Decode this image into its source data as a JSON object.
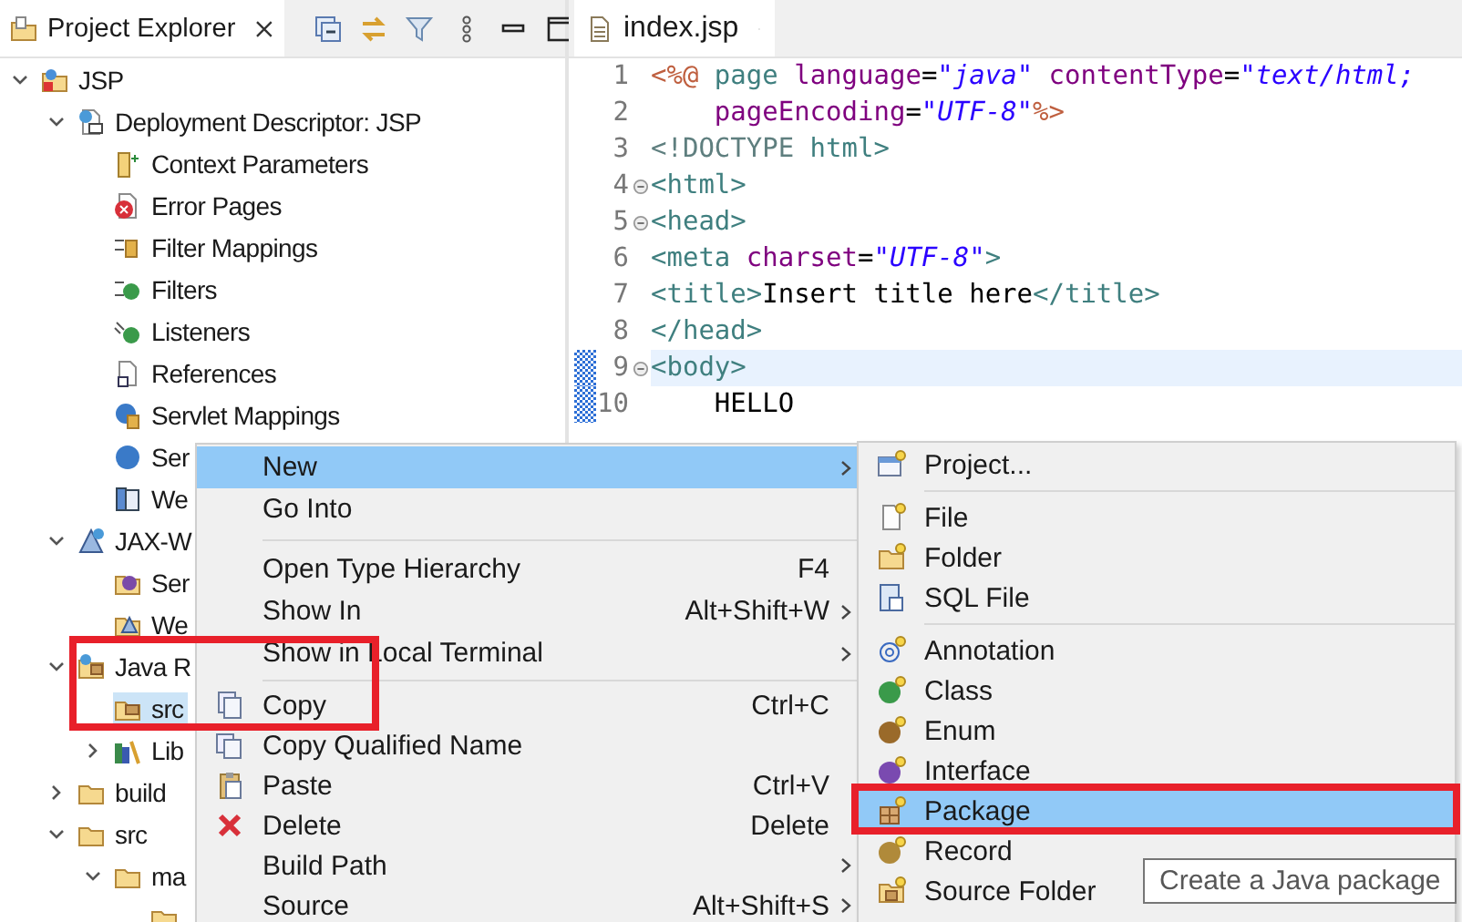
{
  "explorer": {
    "tab": {
      "title": "Project Explorer",
      "selected": true
    },
    "tree": [
      {
        "label": "JSP",
        "kind": "web-project",
        "expanded": true,
        "selected": false,
        "children": [
          {
            "label": "Deployment Descriptor: JSP",
            "kind": "descriptor",
            "expanded": true,
            "selected": false,
            "children": [
              {
                "label": "Context Parameters",
                "kind": "parameters",
                "selected": false
              },
              {
                "label": "Error Pages",
                "kind": "error-page",
                "selected": false
              },
              {
                "label": "Filter Mappings",
                "kind": "filter-mapping",
                "selected": false
              },
              {
                "label": "Filters",
                "kind": "filter",
                "selected": false
              },
              {
                "label": "Listeners",
                "kind": "listener",
                "selected": false
              },
              {
                "label": "References",
                "kind": "reference",
                "selected": false
              },
              {
                "label": "Servlet Mappings",
                "kind": "servlet-mapping",
                "selected": false
              },
              {
                "label": "Ser",
                "kind": "servlet",
                "selected": false
              },
              {
                "label": "We",
                "kind": "welcome",
                "selected": false
              }
            ]
          },
          {
            "label": "JAX-W",
            "kind": "web-services",
            "expanded": true,
            "selected": false,
            "children": [
              {
                "label": "Ser",
                "kind": "service",
                "selected": false
              },
              {
                "label": "We",
                "kind": "web-service",
                "selected": false
              }
            ]
          },
          {
            "label": "Java R",
            "kind": "java-resources",
            "expanded": true,
            "selected": false,
            "children": [
              {
                "label": "src",
                "kind": "source-folder",
                "selected": true
              },
              {
                "label": "Lib",
                "kind": "library",
                "expanded": false,
                "selected": false
              }
            ]
          },
          {
            "label": "build",
            "kind": "folder",
            "expanded": false,
            "selected": false
          },
          {
            "label": "src",
            "kind": "folder",
            "expanded": true,
            "selected": false,
            "children": [
              {
                "label": "ma",
                "kind": "folder",
                "expanded": true,
                "selected": false,
                "children": [
                  {
                    "kind": "folder",
                    "selected": false
                  }
                ]
              }
            ]
          }
        ]
      }
    ]
  },
  "editor": {
    "tab": {
      "title": "index.jsp",
      "selected": true
    },
    "lines": [
      {
        "number": "1",
        "fold": false,
        "current": false,
        "changed": false,
        "tokens": [
          {
            "kind": "directive",
            "text": "<%@"
          },
          {
            "kind": "keyword",
            "text": " page"
          },
          {
            "kind": "attribute",
            "text": " language"
          },
          {
            "kind": "operator",
            "text": "="
          },
          {
            "kind": "string",
            "text": "\"java\""
          },
          {
            "kind": "attribute",
            "text": " contentType"
          },
          {
            "kind": "operator",
            "text": "="
          },
          {
            "kind": "string",
            "text": "\"text/html;"
          }
        ]
      },
      {
        "number": "2",
        "fold": false,
        "current": false,
        "changed": false,
        "tokens": [
          {
            "kind": "attribute",
            "text": "    pageEncoding"
          },
          {
            "kind": "operator",
            "text": "="
          },
          {
            "kind": "string",
            "text": "\"UTF-8\""
          },
          {
            "kind": "directive",
            "text": "%>"
          }
        ]
      },
      {
        "number": "3",
        "fold": false,
        "current": false,
        "changed": false,
        "tokens": [
          {
            "kind": "doctype",
            "text": "<!DOCTYPE"
          },
          {
            "kind": "tag",
            "text": " html>"
          }
        ]
      },
      {
        "number": "4",
        "fold": true,
        "current": false,
        "changed": false,
        "tokens": [
          {
            "kind": "tag",
            "text": "<html>"
          }
        ]
      },
      {
        "number": "5",
        "fold": true,
        "current": false,
        "changed": false,
        "tokens": [
          {
            "kind": "tag",
            "text": "<head>"
          }
        ]
      },
      {
        "number": "6",
        "fold": false,
        "current": false,
        "changed": false,
        "tokens": [
          {
            "kind": "tag",
            "text": "<meta"
          },
          {
            "kind": "attribute",
            "text": " charset"
          },
          {
            "kind": "operator",
            "text": "="
          },
          {
            "kind": "string",
            "text": "\"UTF-8\""
          },
          {
            "kind": "tag",
            "text": ">"
          }
        ]
      },
      {
        "number": "7",
        "fold": false,
        "current": false,
        "changed": false,
        "tokens": [
          {
            "kind": "tag",
            "text": "<title>"
          },
          {
            "kind": "text",
            "text": "Insert title here"
          },
          {
            "kind": "tag",
            "text": "</title>"
          }
        ]
      },
      {
        "number": "8",
        "fold": false,
        "current": false,
        "changed": false,
        "tokens": [
          {
            "kind": "tag",
            "text": "</head>"
          }
        ]
      },
      {
        "number": "9",
        "fold": true,
        "current": true,
        "changed": true,
        "tokens": [
          {
            "kind": "tag",
            "text": "<body>"
          }
        ]
      },
      {
        "number": "10",
        "fold": false,
        "current": false,
        "changed": true,
        "tokens": [
          {
            "kind": "text",
            "text": "    HELLO"
          }
        ]
      }
    ]
  },
  "context_menu": {
    "groups": [
      [
        {
          "label": "New",
          "kind": "plain",
          "submenu": true,
          "selected": true
        },
        {
          "label": "Go Into",
          "kind": "plain",
          "submenu": false,
          "selected": false
        }
      ],
      [
        {
          "label": "Open Type Hierarchy",
          "kind": "plain",
          "shortcut": "F4",
          "submenu": false,
          "selected": false
        },
        {
          "label": "Show In",
          "kind": "plain",
          "shortcut": "Alt+Shift+W",
          "submenu": true,
          "selected": false
        },
        {
          "label": "Show in Local Terminal",
          "kind": "plain",
          "submenu": true,
          "selected": false
        }
      ],
      [
        {
          "label": "Copy",
          "kind": "copy",
          "shortcut": "Ctrl+C",
          "submenu": false,
          "selected": false
        },
        {
          "label": "Copy Qualified Name",
          "kind": "copy-name",
          "submenu": false,
          "selected": false
        },
        {
          "label": "Paste",
          "kind": "paste",
          "shortcut": "Ctrl+V",
          "submenu": false,
          "selected": false
        },
        {
          "label": "Delete",
          "kind": "delete",
          "shortcut": "Delete",
          "submenu": false,
          "selected": false
        },
        {
          "label": "Build Path",
          "kind": "plain",
          "submenu": true,
          "selected": false
        },
        {
          "label": "Source",
          "kind": "plain",
          "shortcut": "Alt+Shift+S",
          "submenu": true,
          "selected": false
        }
      ]
    ]
  },
  "submenu": {
    "groups": [
      [
        {
          "label": "Project...",
          "kind": "project",
          "selected": false
        }
      ],
      [
        {
          "label": "File",
          "kind": "file",
          "selected": false
        },
        {
          "label": "Folder",
          "kind": "new-folder",
          "selected": false
        },
        {
          "label": "SQL File",
          "kind": "sql-file",
          "selected": false
        }
      ],
      [
        {
          "label": "Annotation",
          "kind": "annotation",
          "selected": false
        },
        {
          "label": "Class",
          "kind": "class",
          "selected": false
        },
        {
          "label": "Enum",
          "kind": "enum",
          "selected": false
        },
        {
          "label": "Interface",
          "kind": "interface",
          "selected": false
        },
        {
          "label": "Package",
          "kind": "package",
          "selected": true
        },
        {
          "label": "Record",
          "kind": "record",
          "selected": false
        },
        {
          "label": "Source Folder",
          "kind": "new-source-folder",
          "selected": false
        }
      ]
    ]
  },
  "tooltip": "Create a Java package",
  "annotations": [
    {
      "kind": "frame"
    },
    {
      "kind": "frame"
    }
  ]
}
